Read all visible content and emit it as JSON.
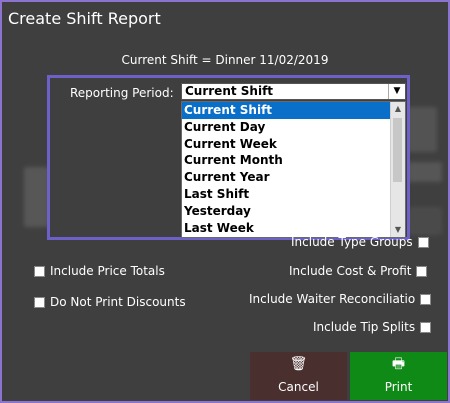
{
  "dialog": {
    "title": "Create Shift Report"
  },
  "current_shift": "Current Shift = Dinner 11/02/2019",
  "reporting": {
    "label": "Reporting Period:",
    "selected": "Current Shift",
    "options": [
      "Current Shift",
      "Current Day",
      "Current Week",
      "Current Month",
      "Current Year",
      "Last Shift",
      "Yesterday",
      "Last Week"
    ]
  },
  "options": {
    "include_type_groups": "Include Type Groups",
    "include_price_totals": "Include Price Totals",
    "do_not_print_discounts": "Do Not Print Discounts",
    "include_cost_profit": "Include Cost & Profit",
    "include_waiter_reconciliation": "Include Waiter Reconciliatio",
    "include_tip_splits": "Include Tip Splits"
  },
  "buttons": {
    "cancel": "Cancel",
    "print": "Print"
  },
  "colors": {
    "accent": "#6d60c9",
    "selected": "#0a6fc9",
    "print": "#108a16",
    "cancel": "#4a2f2f"
  }
}
